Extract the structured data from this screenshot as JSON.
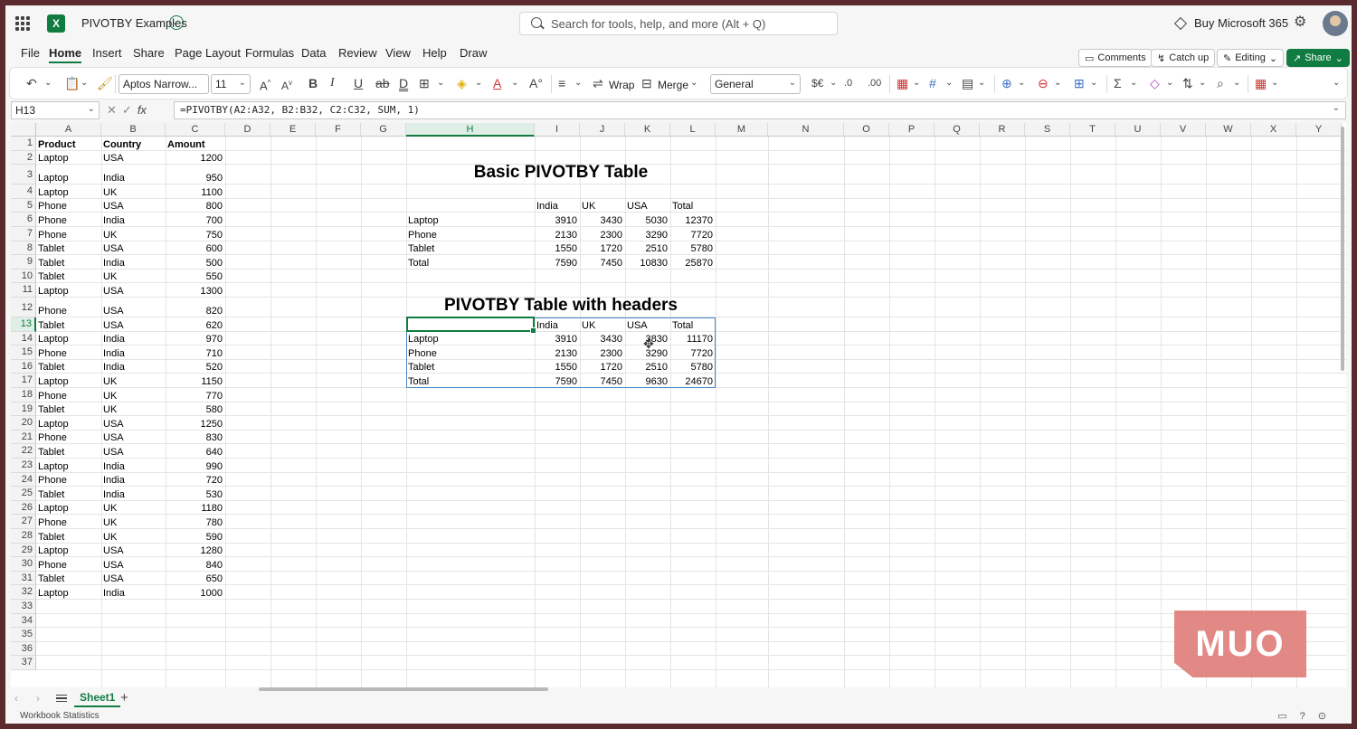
{
  "app": {
    "doc_title": "PIVOTBY Examples",
    "search_placeholder": "Search for tools, help, and more (Alt + Q)",
    "buy_label": "Buy Microsoft 365"
  },
  "menu": {
    "items": [
      "File",
      "Home",
      "Insert",
      "Share",
      "Page Layout",
      "Formulas",
      "Data",
      "Review",
      "View",
      "Help",
      "Draw"
    ],
    "active": "Home",
    "comments_label": "Comments",
    "catchup_label": "Catch up",
    "editing_label": "Editing",
    "share_label": "Share"
  },
  "ribbon": {
    "font_name": "Aptos Narrow...",
    "font_size": "11",
    "wrap_label": "Wrap",
    "merge_label": "Merge",
    "number_format": "General"
  },
  "formula_bar": {
    "name_box": "H13",
    "formula": "=PIVOTBY(A2:A32, B2:B32, C2:C32, SUM, 1)"
  },
  "columns": [
    "A",
    "B",
    "C",
    "D",
    "E",
    "F",
    "G",
    "H",
    "I",
    "J",
    "K",
    "L",
    "M",
    "N",
    "O",
    "P",
    "Q",
    "R",
    "S",
    "T",
    "U",
    "V",
    "W",
    "X",
    "Y"
  ],
  "selected_column": "H",
  "selected_row": "13",
  "source_table": {
    "headers": [
      "Product",
      "Country",
      "Amount"
    ],
    "rows": [
      [
        "Laptop",
        "USA",
        "1200"
      ],
      [
        "Laptop",
        "India",
        "950"
      ],
      [
        "Laptop",
        "UK",
        "1100"
      ],
      [
        "Phone",
        "USA",
        "800"
      ],
      [
        "Phone",
        "India",
        "700"
      ],
      [
        "Phone",
        "UK",
        "750"
      ],
      [
        "Tablet",
        "USA",
        "600"
      ],
      [
        "Tablet",
        "India",
        "500"
      ],
      [
        "Tablet",
        "UK",
        "550"
      ],
      [
        "Laptop",
        "USA",
        "1300"
      ],
      [
        "Phone",
        "USA",
        "820"
      ],
      [
        "Tablet",
        "USA",
        "620"
      ],
      [
        "Laptop",
        "India",
        "970"
      ],
      [
        "Phone",
        "India",
        "710"
      ],
      [
        "Tablet",
        "India",
        "520"
      ],
      [
        "Laptop",
        "UK",
        "1150"
      ],
      [
        "Phone",
        "UK",
        "770"
      ],
      [
        "Tablet",
        "UK",
        "580"
      ],
      [
        "Laptop",
        "USA",
        "1250"
      ],
      [
        "Phone",
        "USA",
        "830"
      ],
      [
        "Tablet",
        "USA",
        "640"
      ],
      [
        "Laptop",
        "India",
        "990"
      ],
      [
        "Phone",
        "India",
        "720"
      ],
      [
        "Tablet",
        "India",
        "530"
      ],
      [
        "Laptop",
        "UK",
        "1180"
      ],
      [
        "Phone",
        "UK",
        "780"
      ],
      [
        "Tablet",
        "UK",
        "590"
      ],
      [
        "Laptop",
        "USA",
        "1280"
      ],
      [
        "Phone",
        "USA",
        "840"
      ],
      [
        "Tablet",
        "USA",
        "650"
      ],
      [
        "Laptop",
        "India",
        "1000"
      ]
    ]
  },
  "pivot1": {
    "title": "Basic PIVOTBY Table",
    "headers": [
      "India",
      "UK",
      "USA",
      "Total"
    ],
    "rows": [
      [
        "Laptop",
        "3910",
        "3430",
        "5030",
        "12370"
      ],
      [
        "Phone",
        "2130",
        "2300",
        "3290",
        "7720"
      ],
      [
        "Tablet",
        "1550",
        "1720",
        "2510",
        "5780"
      ],
      [
        "Total",
        "7590",
        "7450",
        "10830",
        "25870"
      ]
    ]
  },
  "pivot2": {
    "title": "PIVOTBY Table with headers",
    "headers": [
      "India",
      "UK",
      "USA",
      "Total"
    ],
    "rows": [
      [
        "Laptop",
        "3910",
        "3430",
        "3830",
        "11170"
      ],
      [
        "Phone",
        "2130",
        "2300",
        "3290",
        "7720"
      ],
      [
        "Tablet",
        "1550",
        "1720",
        "2510",
        "5780"
      ],
      [
        "Total",
        "7590",
        "7450",
        "9630",
        "24670"
      ]
    ]
  },
  "sheet": {
    "tab_name": "Sheet1"
  },
  "status": {
    "label": "Workbook Statistics"
  },
  "watermark": "MUO"
}
